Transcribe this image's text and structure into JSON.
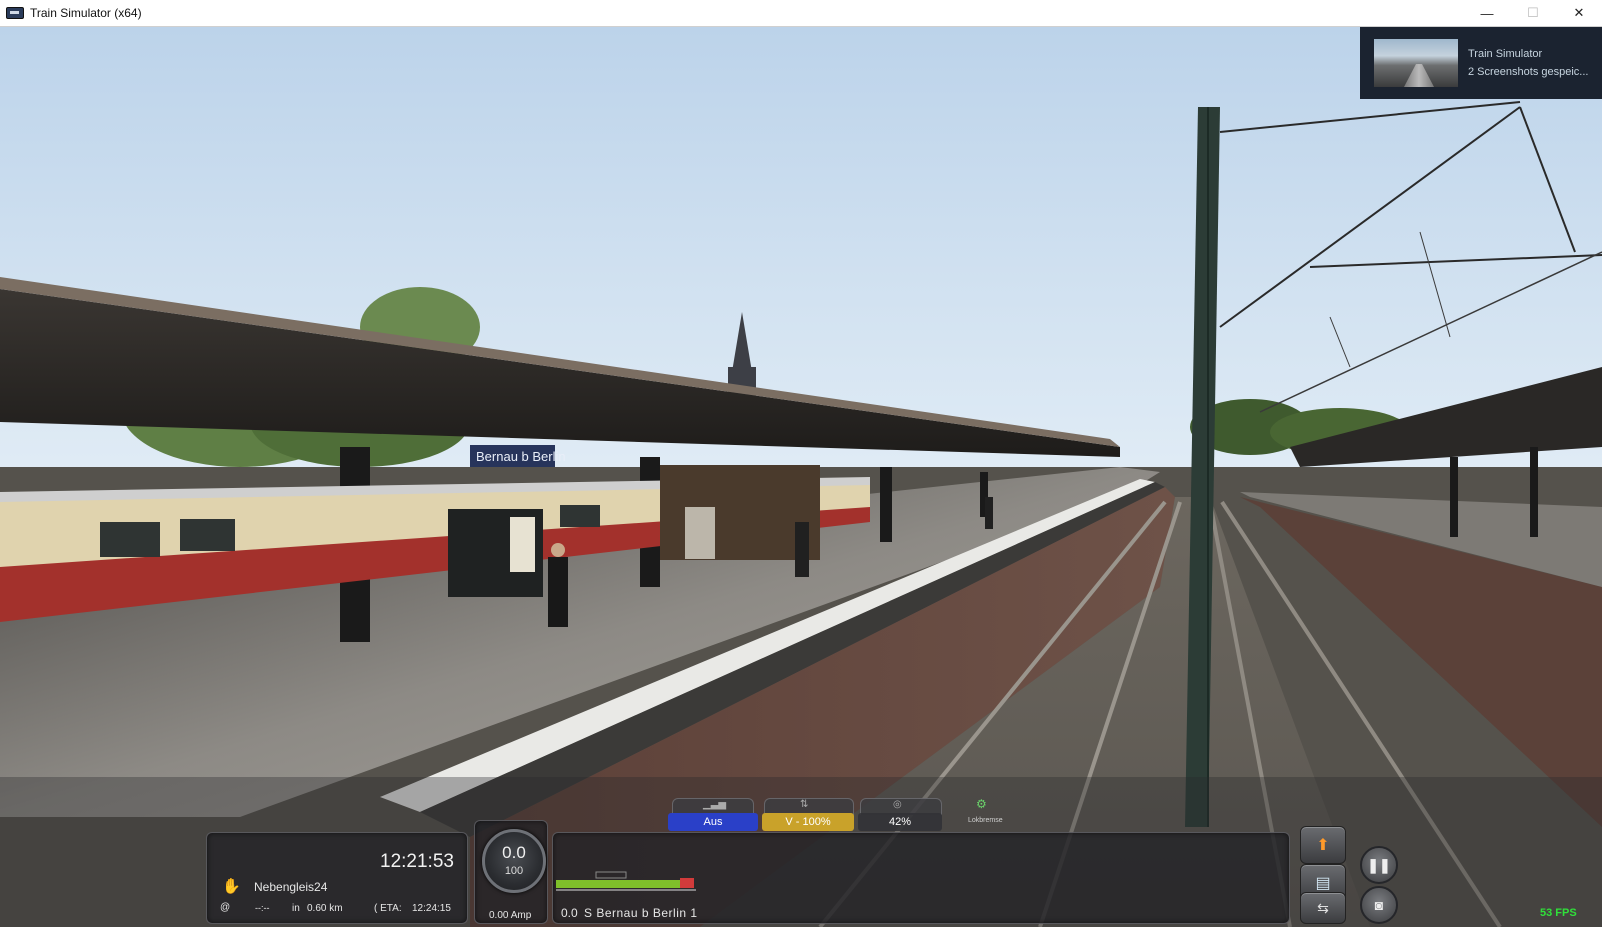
{
  "window": {
    "title": "Train Simulator (x64)",
    "minimize": "—",
    "maximize": "☐",
    "close": "✕"
  },
  "notification": {
    "app": "Train Simulator",
    "message": "2 Screenshots gespeic..."
  },
  "scene": {
    "station_sign": "Bernau b Berlin"
  },
  "hud": {
    "clock": "12:21:53",
    "signal_name": "Nebengleis24",
    "at_symbol": "@",
    "distance_placeholder": "--:--",
    "in_label": "in",
    "distance": "0.60 km",
    "eta_label": "( ETA:",
    "eta_time": "12:24:15",
    "speed_value": "0.0",
    "speed_limit": "100",
    "amperage": "0.00 Amp",
    "tabs": {
      "pzb": "Aus",
      "reverser": "V - 100%",
      "brake": "42%",
      "loco_brake": "Lokbremse"
    },
    "track_position": "0.0",
    "next_stop": "S Bernau b Berlin 1",
    "fps": "53 FPS"
  },
  "colors": {
    "tab_blue": "#2a40c8",
    "tab_yellow": "#c9a22a",
    "fps_green": "#30e03a"
  }
}
